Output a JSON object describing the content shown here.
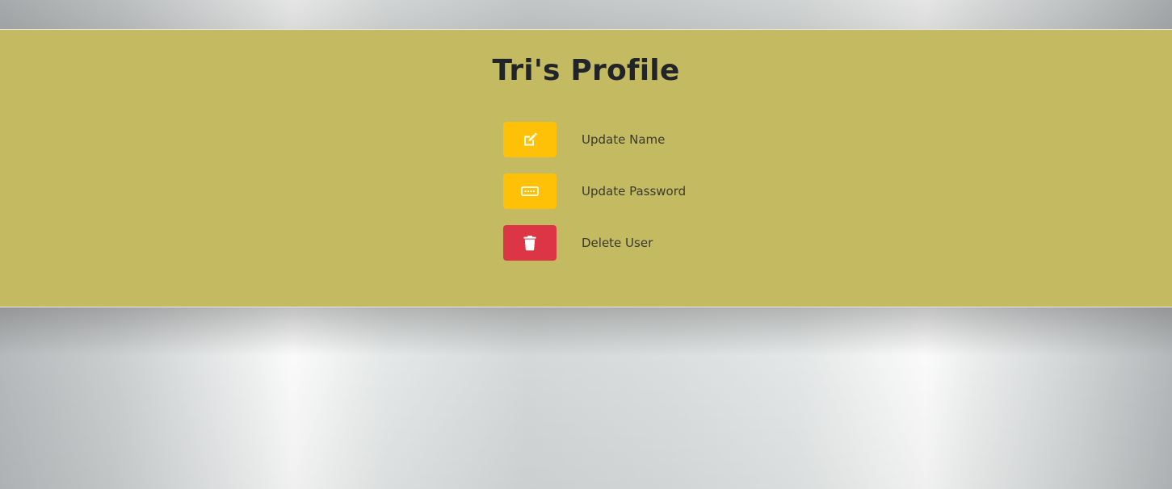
{
  "colors": {
    "panel_background": "#c4ba61",
    "title_text": "#212529",
    "warning_button": "#ffc107",
    "danger_button": "#dc3545",
    "icon_color": "#ffffff"
  },
  "profile": {
    "title": "Tri's Profile",
    "actions": [
      {
        "label": "Update Name",
        "icon": "edit-icon",
        "variant": "warning"
      },
      {
        "label": "Update Password",
        "icon": "password-icon",
        "variant": "warning"
      },
      {
        "label": "Delete User",
        "icon": "trash-icon",
        "variant": "danger"
      }
    ]
  }
}
